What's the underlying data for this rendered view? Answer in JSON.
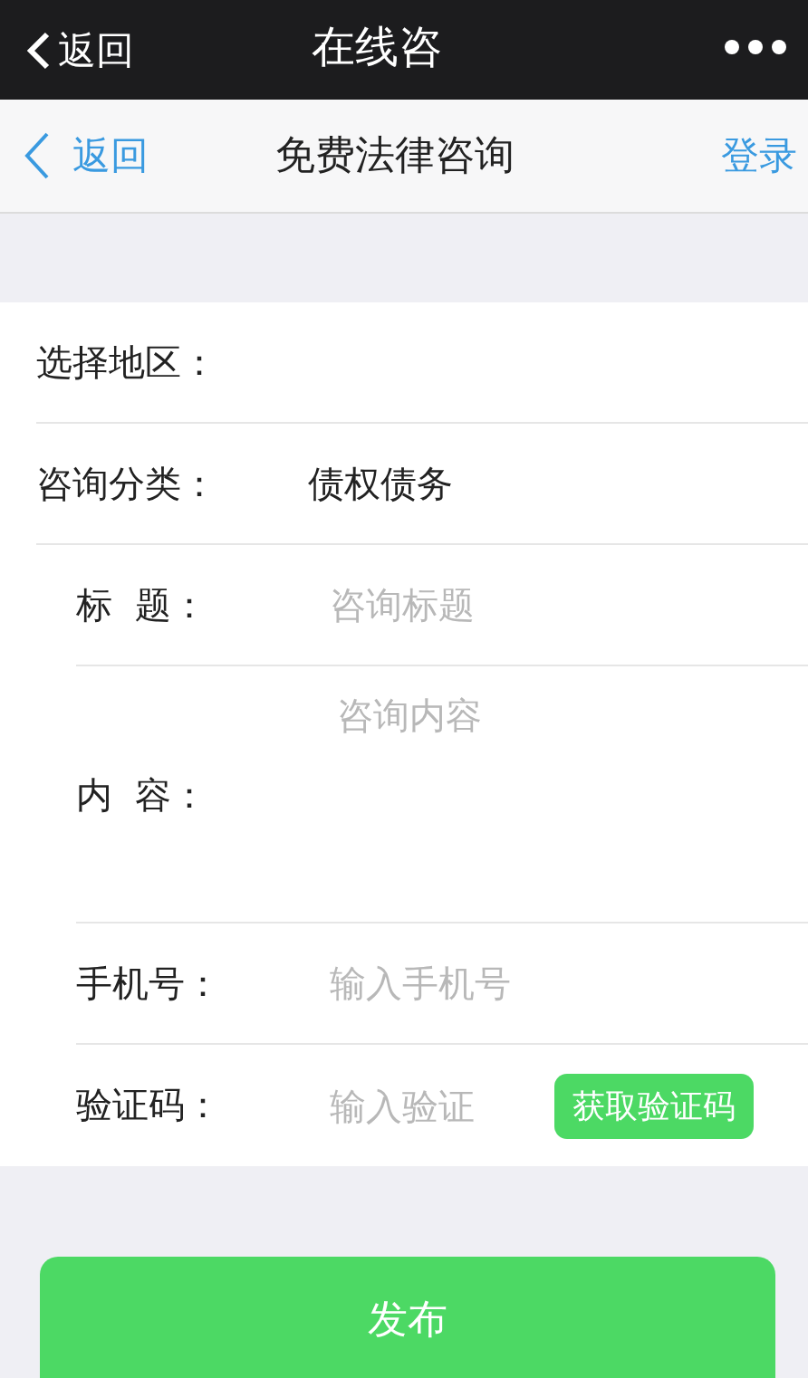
{
  "status_bar": {
    "back": "返回",
    "title": "在线咨"
  },
  "nav": {
    "back": "返回",
    "title": "免费法律咨询",
    "action": "登录"
  },
  "form": [
    {
      "kind": "select",
      "label": "选择地区："
    },
    {
      "kind": "select",
      "label": "咨询分类：",
      "value": "债权债务"
    },
    {
      "kind": "input",
      "label": "标  题：",
      "placeholder": "咨询标题"
    },
    {
      "kind": "textarea",
      "label": "内  容：",
      "placeholder": "咨询内容"
    },
    {
      "kind": "input",
      "label": "手机号：",
      "placeholder": "输入手机号"
    },
    {
      "kind": "code",
      "label": "验证码：",
      "placeholder": "输入验证",
      "button": "获取验证码"
    }
  ],
  "submit": "发布"
}
